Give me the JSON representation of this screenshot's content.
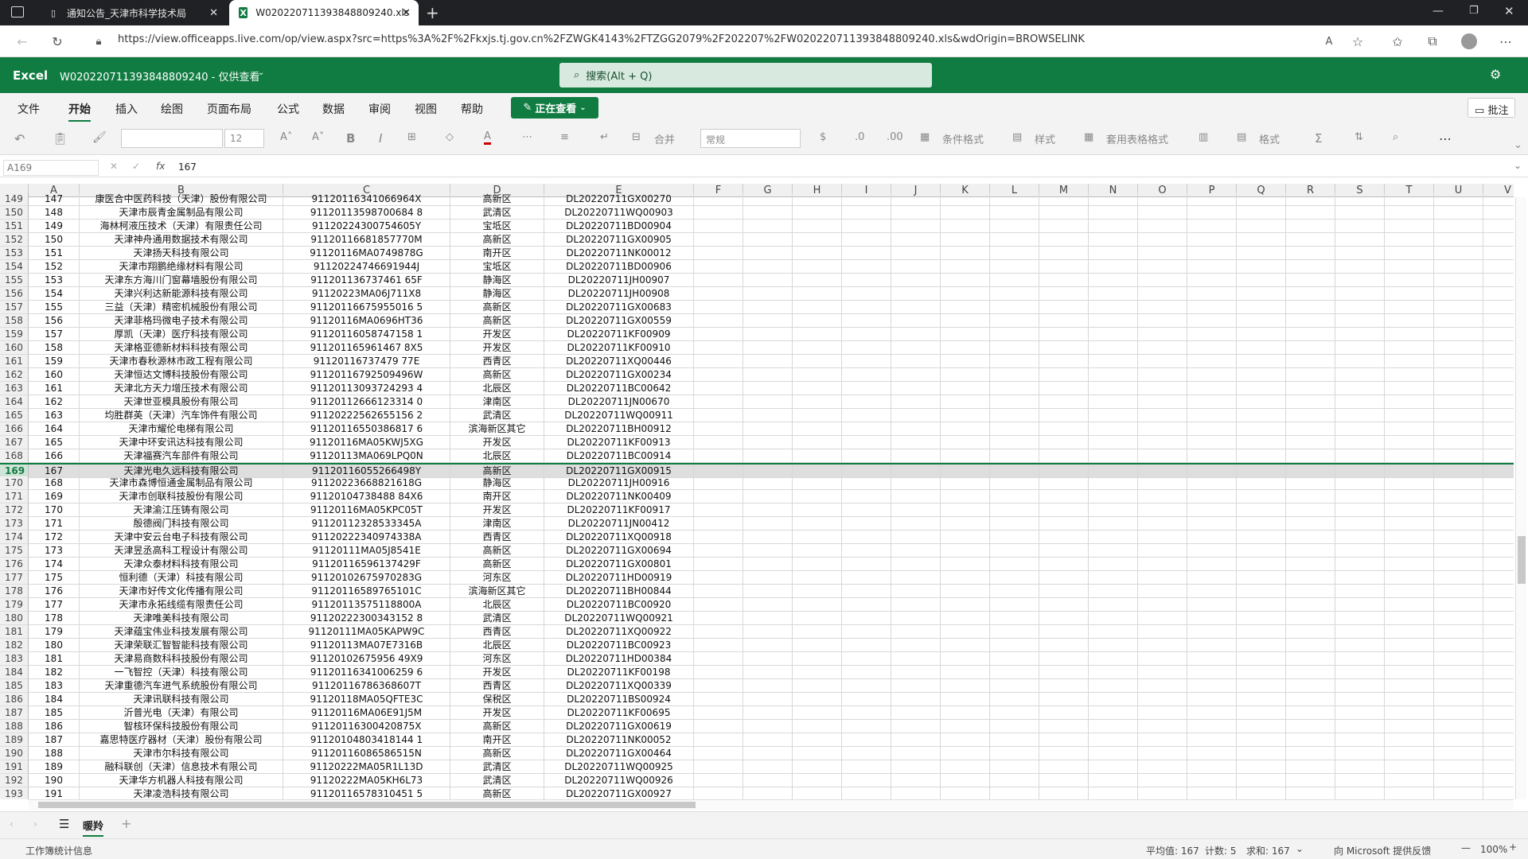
{
  "browser": {
    "tabs": [
      {
        "title": "通知公告_天津市科学技术局",
        "active": false
      },
      {
        "title": "W020220711393848809240.xls",
        "active": true
      }
    ],
    "url": "https://view.officeapps.live.com/op/view.aspx?src=https%3A%2F%2Fkxjs.tj.gov.cn%2FZWGK4143%2FTZGG2079%2F202207%2FW020220711393848809240.xls&wdOrigin=BROWSELINK"
  },
  "excel": {
    "app_name": "Excel",
    "file_title": "W020220711393848809240 - 仅供查看",
    "search_placeholder": "搜索(Alt + Q)",
    "ribbon_tabs": [
      "文件",
      "开始",
      "插入",
      "绘图",
      "页面布局",
      "公式",
      "数据",
      "审阅",
      "视图",
      "帮助"
    ],
    "viewing_label": "正在查看",
    "comment_label": "批注",
    "toolbar": {
      "font_size": "12",
      "number_format": "常规",
      "merge": "合并",
      "cond_format": "条件格式",
      "styles": "样式",
      "table_format": "套用表格格式",
      "format": "格式"
    },
    "name_box": "A169",
    "formula_value": "167",
    "columns": [
      "A",
      "B",
      "C",
      "D",
      "E",
      "F",
      "G",
      "H",
      "I",
      "J",
      "K",
      "L",
      "M",
      "N",
      "O",
      "P",
      "Q",
      "R",
      "S",
      "T",
      "U",
      "V"
    ],
    "selected_row": 169,
    "rows": [
      {
        "r": "149",
        "a": "147",
        "b": "康医合中医药科技（天津）股份有限公司",
        "c": "91120116341066964X",
        "d": "高新区",
        "e": "DL20220711GX00270"
      },
      {
        "r": "150",
        "a": "148",
        "b": "天津市辰青金属制品有限公司",
        "c": "91120113598700684 8",
        "d": "武清区",
        "e": "DL20220711WQ00903"
      },
      {
        "r": "151",
        "a": "149",
        "b": "海林柯液压技术（天津）有限责任公司",
        "c": "91120224300754605Y",
        "d": "宝坻区",
        "e": "DL20220711BD00904"
      },
      {
        "r": "152",
        "a": "150",
        "b": "天津神舟通用数据技术有限公司",
        "c": "91120116681857770M",
        "d": "高新区",
        "e": "DL20220711GX00905"
      },
      {
        "r": "153",
        "a": "151",
        "b": "天津扬天科技有限公司",
        "c": "91120116MA0749878G",
        "d": "南开区",
        "e": "DL20220711NK00012"
      },
      {
        "r": "154",
        "a": "152",
        "b": "天津市翔鹏绝缘材料有限公司",
        "c": "91120224746691944J",
        "d": "宝坻区",
        "e": "DL20220711BD00906"
      },
      {
        "r": "155",
        "a": "153",
        "b": "天津东方海川门窗幕墙股份有限公司",
        "c": "911201136737461 65F",
        "d": "静海区",
        "e": "DL20220711JH00907"
      },
      {
        "r": "156",
        "a": "154",
        "b": "天津兴利达新能源科技有限公司",
        "c": "91120223MA06J711X8",
        "d": "静海区",
        "e": "DL20220711JH00908"
      },
      {
        "r": "157",
        "a": "155",
        "b": "三益（天津）精密机械股份有限公司",
        "c": "91120116675955016 5",
        "d": "高新区",
        "e": "DL20220711GX00683"
      },
      {
        "r": "158",
        "a": "156",
        "b": "天津菲格玛微电子技术有限公司",
        "c": "91120116MA0696HT36",
        "d": "高新区",
        "e": "DL20220711GX00559"
      },
      {
        "r": "159",
        "a": "157",
        "b": "厚凯（天津）医疗科技有限公司",
        "c": "91120116058747158 1",
        "d": "开发区",
        "e": "DL20220711KF00909"
      },
      {
        "r": "160",
        "a": "158",
        "b": "天津格亚德新材料科技有限公司",
        "c": "911201165961467 8X5",
        "d": "开发区",
        "e": "DL20220711KF00910"
      },
      {
        "r": "161",
        "a": "159",
        "b": "天津市春秋源林市政工程有限公司",
        "c": "91120116737479 77E",
        "d": "西青区",
        "e": "DL20220711XQ00446"
      },
      {
        "r": "162",
        "a": "160",
        "b": "天津恒达文博科技股份有限公司",
        "c": "91120116792509496W",
        "d": "高新区",
        "e": "DL20220711GX00234"
      },
      {
        "r": "163",
        "a": "161",
        "b": "天津北方天力增压技术有限公司",
        "c": "91120113093724293 4",
        "d": "北辰区",
        "e": "DL20220711BC00642"
      },
      {
        "r": "164",
        "a": "162",
        "b": "天津世亚模具股份有限公司",
        "c": "91120112666123314 0",
        "d": "津南区",
        "e": "DL20220711JN00670"
      },
      {
        "r": "165",
        "a": "163",
        "b": "均胜群英（天津）汽车饰件有限公司",
        "c": "91120222562655156 2",
        "d": "武清区",
        "e": "DL20220711WQ00911"
      },
      {
        "r": "166",
        "a": "164",
        "b": "天津市耀伦电梯有限公司",
        "c": "91120116550386817 6",
        "d": "滨海新区其它",
        "e": "DL20220711BH00912"
      },
      {
        "r": "167",
        "a": "165",
        "b": "天津中环安讯达科技有限公司",
        "c": "91120116MA05KWJ5XG",
        "d": "开发区",
        "e": "DL20220711KF00913"
      },
      {
        "r": "168",
        "a": "166",
        "b": "天津福赛汽车部件有限公司",
        "c": "91120113MA069LPQ0N",
        "d": "北辰区",
        "e": "DL20220711BC00914"
      },
      {
        "r": "169",
        "a": "167",
        "b": "天津光电久远科技有限公司",
        "c": "91120116055266498Y",
        "d": "高新区",
        "e": "DL20220711GX00915"
      },
      {
        "r": "170",
        "a": "168",
        "b": "天津市森博恒通金属制品有限公司",
        "c": "91120223668821618G",
        "d": "静海区",
        "e": "DL20220711JH00916"
      },
      {
        "r": "171",
        "a": "169",
        "b": "天津市创联科技股份有限公司",
        "c": "91120104738488 84X6",
        "d": "南开区",
        "e": "DL20220711NK00409"
      },
      {
        "r": "172",
        "a": "170",
        "b": "天津渝江压铸有限公司",
        "c": "91120116MA05KPC05T",
        "d": "开发区",
        "e": "DL20220711KF00917"
      },
      {
        "r": "173",
        "a": "171",
        "b": "殷德阀门科技有限公司",
        "c": "91120112328533345A",
        "d": "津南区",
        "e": "DL20220711JN00412"
      },
      {
        "r": "174",
        "a": "172",
        "b": "天津中安云台电子科技有限公司",
        "c": "91120222340974338A",
        "d": "西青区",
        "e": "DL20220711XQ00918"
      },
      {
        "r": "175",
        "a": "173",
        "b": "天津昱丞高科工程设计有限公司",
        "c": "91120111MA05J8541E",
        "d": "高新区",
        "e": "DL20220711GX00694"
      },
      {
        "r": "176",
        "a": "174",
        "b": "天津众泰材料科技有限公司",
        "c": "91120116596137429F",
        "d": "高新区",
        "e": "DL20220711GX00801"
      },
      {
        "r": "177",
        "a": "175",
        "b": "恒利德（天津）科技有限公司",
        "c": "91120102675970283G",
        "d": "河东区",
        "e": "DL20220711HD00919"
      },
      {
        "r": "178",
        "a": "176",
        "b": "天津市好传文化传播有限公司",
        "c": "91120116589765101C",
        "d": "滨海新区其它",
        "e": "DL20220711BH00844"
      },
      {
        "r": "179",
        "a": "177",
        "b": "天津市永拓线缆有限责任公司",
        "c": "91120113575118800A",
        "d": "北辰区",
        "e": "DL20220711BC00920"
      },
      {
        "r": "180",
        "a": "178",
        "b": "天津唯美科技有限公司",
        "c": "91120222300343152 8",
        "d": "武清区",
        "e": "DL20220711WQ00921"
      },
      {
        "r": "181",
        "a": "179",
        "b": "天津蕴宝伟业科技发展有限公司",
        "c": "91120111MA05KAPW9C",
        "d": "西青区",
        "e": "DL20220711XQ00922"
      },
      {
        "r": "182",
        "a": "180",
        "b": "天津荣联汇智智能科技有限公司",
        "c": "91120113MA07E7316B",
        "d": "北辰区",
        "e": "DL20220711BC00923"
      },
      {
        "r": "183",
        "a": "181",
        "b": "天津易商数科科技股份有限公司",
        "c": "91120102675956 49X9",
        "d": "河东区",
        "e": "DL20220711HD00384"
      },
      {
        "r": "184",
        "a": "182",
        "b": "一飞智控（天津）科技有限公司",
        "c": "91120116341006259 6",
        "d": "开发区",
        "e": "DL20220711KF00198"
      },
      {
        "r": "185",
        "a": "183",
        "b": "天津重德汽车进气系统股份有限公司",
        "c": "91120116786368607T",
        "d": "西青区",
        "e": "DL20220711XQ00339"
      },
      {
        "r": "186",
        "a": "184",
        "b": "天津讯联科技有限公司",
        "c": "91120118MA05QFTE3C",
        "d": "保税区",
        "e": "DL20220711BS00924"
      },
      {
        "r": "187",
        "a": "185",
        "b": "沂普光电（天津）有限公司",
        "c": "91120116MA06E91J5M",
        "d": "开发区",
        "e": "DL20220711KF00695"
      },
      {
        "r": "188",
        "a": "186",
        "b": "智核环保科技股份有限公司",
        "c": "91120116300420875X",
        "d": "高新区",
        "e": "DL20220711GX00619"
      },
      {
        "r": "189",
        "a": "187",
        "b": "嘉思特医疗器材（天津）股份有限公司",
        "c": "91120104803418144 1",
        "d": "南开区",
        "e": "DL20220711NK00052"
      },
      {
        "r": "190",
        "a": "188",
        "b": "天津市尔科技有限公司",
        "c": "91120116086586515N",
        "d": "高新区",
        "e": "DL20220711GX00464"
      },
      {
        "r": "191",
        "a": "189",
        "b": "融科联创（天津）信息技术有限公司",
        "c": "91120222MA05R1L13D",
        "d": "武清区",
        "e": "DL20220711WQ00925"
      },
      {
        "r": "192",
        "a": "190",
        "b": "天津华方机器人科技有限公司",
        "c": "91120222MA05KH6L73",
        "d": "武清区",
        "e": "DL20220711WQ00926"
      },
      {
        "r": "193",
        "a": "191",
        "b": "天津凌浩科技有限公司",
        "c": "91120116578310451 5",
        "d": "高新区",
        "e": "DL20220711GX00927"
      }
    ],
    "sheet_tab": "暖羚",
    "status": {
      "left": "工作簿统计信息",
      "average": "平均值: 167",
      "count": "计数: 5",
      "sum": "求和: 167",
      "feedback": "向 Microsoft 提供反馈",
      "zoom": "100%"
    }
  },
  "colors": {
    "excel_green": "#107c41",
    "tabbar": "#202124"
  }
}
